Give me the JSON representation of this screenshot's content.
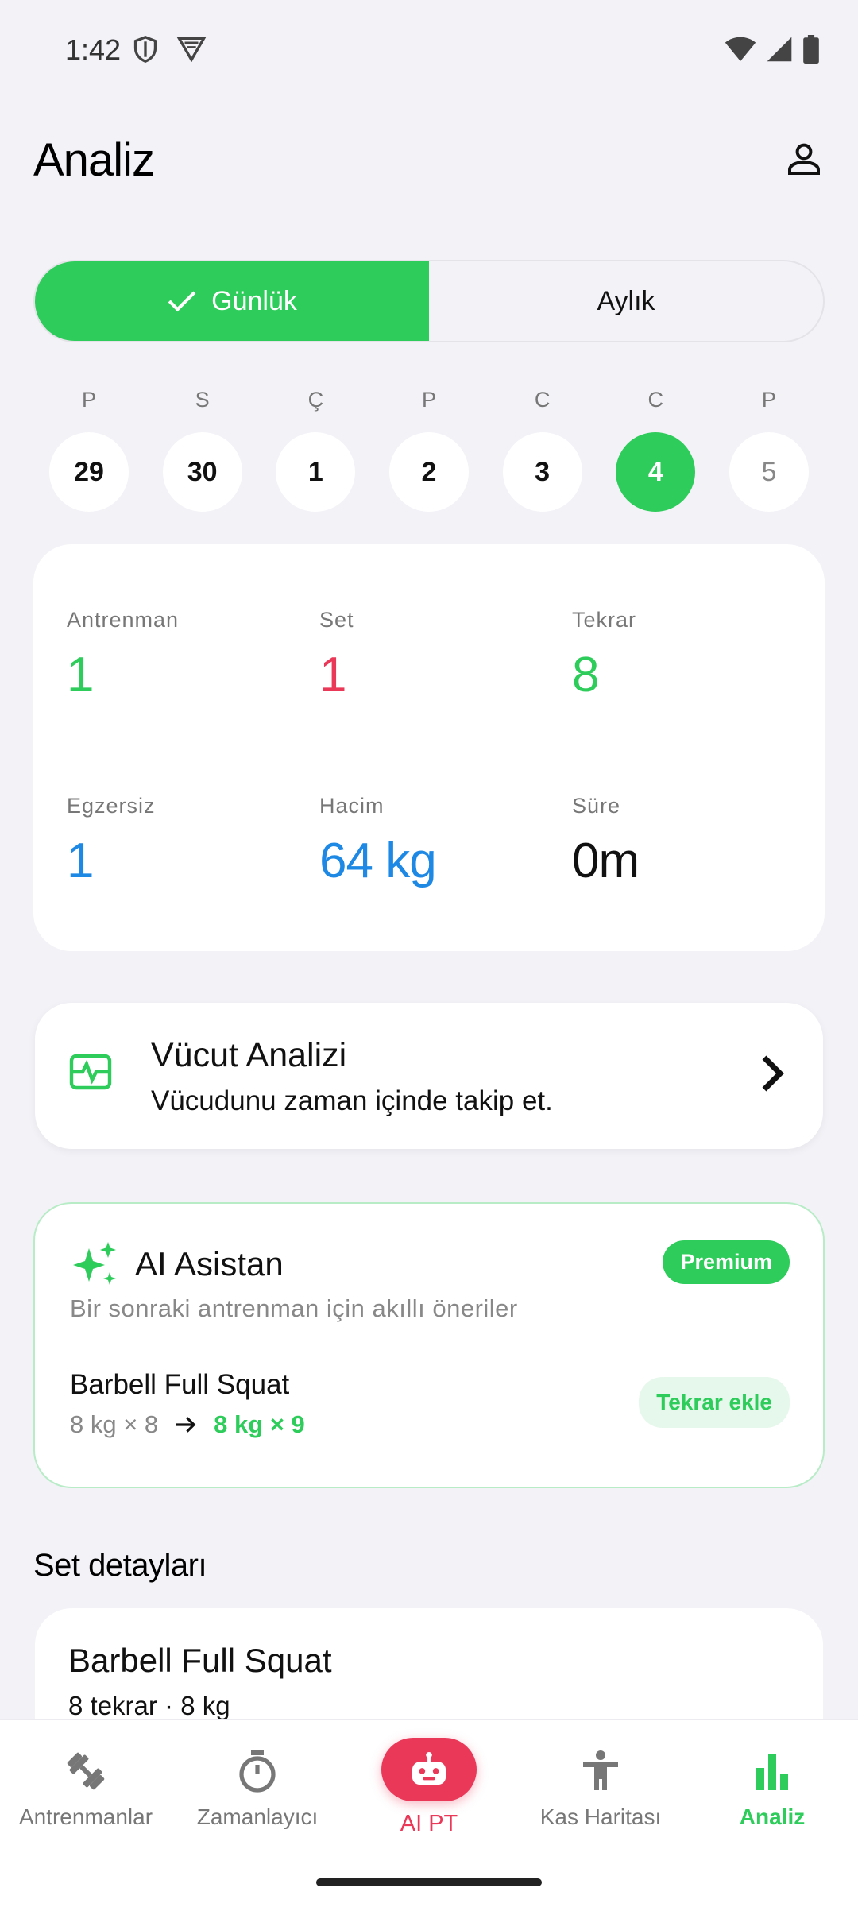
{
  "status_bar": {
    "time": "1:42"
  },
  "header": {
    "title": "Analiz"
  },
  "segment": {
    "daily": "Günlük",
    "monthly": "Aylık"
  },
  "days": [
    {
      "letter": "P",
      "num": "29"
    },
    {
      "letter": "S",
      "num": "30"
    },
    {
      "letter": "Ç",
      "num": "1"
    },
    {
      "letter": "P",
      "num": "2"
    },
    {
      "letter": "C",
      "num": "3"
    },
    {
      "letter": "C",
      "num": "4"
    },
    {
      "letter": "P",
      "num": "5"
    }
  ],
  "stats": {
    "workout": {
      "label": "Antrenman",
      "value": "1"
    },
    "set": {
      "label": "Set",
      "value": "1"
    },
    "reps": {
      "label": "Tekrar",
      "value": "8"
    },
    "exercise": {
      "label": "Egzersiz",
      "value": "1"
    },
    "volume": {
      "label": "Hacim",
      "value": "64 kg"
    },
    "duration": {
      "label": "Süre",
      "value": "0m"
    }
  },
  "body_analysis": {
    "title": "Vücut Analizi",
    "subtitle": "Vücudunu zaman içinde takip et."
  },
  "ai_assistant": {
    "title": "AI Asistan",
    "badge": "Premium",
    "subtitle": "Bir sonraki antrenman için akıllı öneriler",
    "exercise": "Barbell Full Squat",
    "current": "8 kg × 8",
    "suggested": "8 kg × 9",
    "action": "Tekrar ekle"
  },
  "set_details": {
    "title": "Set detayları",
    "exercise": "Barbell Full Squat",
    "summary": "8 tekrar · 8 kg"
  },
  "nav": {
    "workouts": "Antrenmanlar",
    "timer": "Zamanlayıcı",
    "ai_pt": "AI PT",
    "muscle_map": "Kas Haritası",
    "analysis": "Analiz"
  },
  "colors": {
    "accent_green": "#2ecc5a",
    "accent_red": "#ea3858",
    "accent_blue": "#1e88e5"
  }
}
